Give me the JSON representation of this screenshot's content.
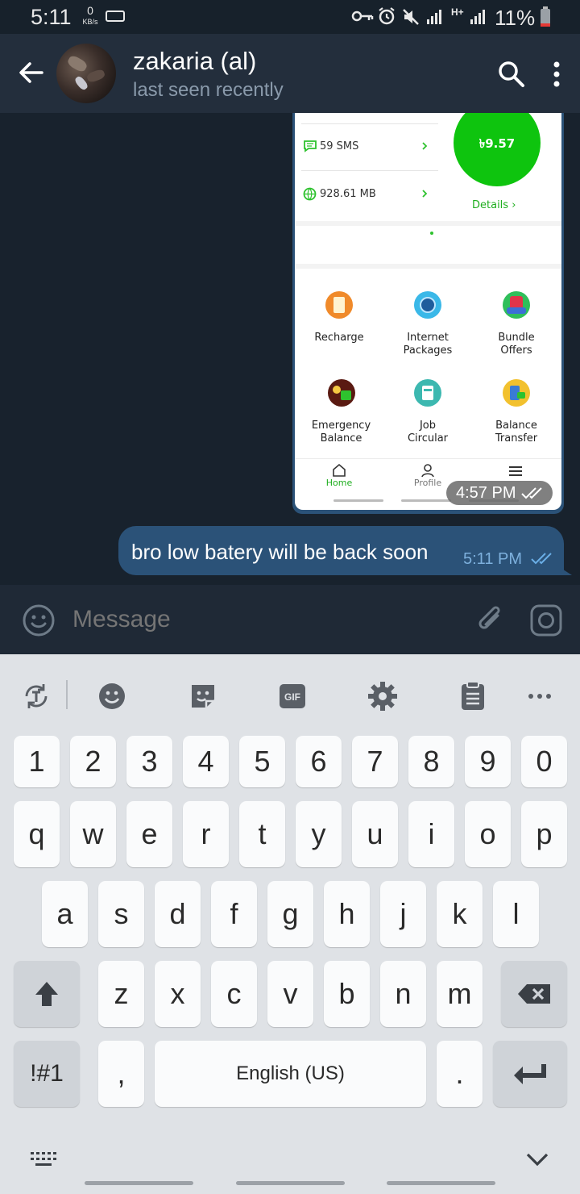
{
  "status": {
    "time": "5:11",
    "speed": "0",
    "speed_unit": "KB/s",
    "network": "H+",
    "battery": "11%"
  },
  "header": {
    "name": "zakaria (al)",
    "subtitle": "last seen recently"
  },
  "screenshot": {
    "sms": "59 SMS",
    "data": "928.61 MB",
    "balance": "৳9.57",
    "details": "Details",
    "tiles": [
      {
        "l1": "Recharge",
        "l2": ""
      },
      {
        "l1": "Internet",
        "l2": "Packages"
      },
      {
        "l1": "Bundle",
        "l2": "Offers"
      },
      {
        "l1": "Emergency",
        "l2": "Balance"
      },
      {
        "l1": "Job",
        "l2": "Circular"
      },
      {
        "l1": "Balance",
        "l2": "Transfer"
      }
    ],
    "nav": {
      "home": "Home",
      "profile": "Profile"
    },
    "time": "4:57 PM"
  },
  "message": {
    "text": "bro low batery will be back soon",
    "time": "5:11 PM"
  },
  "input": {
    "placeholder": "Message"
  },
  "keyboard": {
    "numbers": [
      "1",
      "2",
      "3",
      "4",
      "5",
      "6",
      "7",
      "8",
      "9",
      "0"
    ],
    "row1": [
      "q",
      "w",
      "e",
      "r",
      "t",
      "y",
      "u",
      "i",
      "o",
      "p"
    ],
    "row2": [
      "a",
      "s",
      "d",
      "f",
      "g",
      "h",
      "j",
      "k",
      "l"
    ],
    "row3": [
      "z",
      "x",
      "c",
      "v",
      "b",
      "n",
      "m"
    ],
    "symbols": "!#1",
    "comma": ",",
    "space": "English (US)",
    "period": "."
  }
}
